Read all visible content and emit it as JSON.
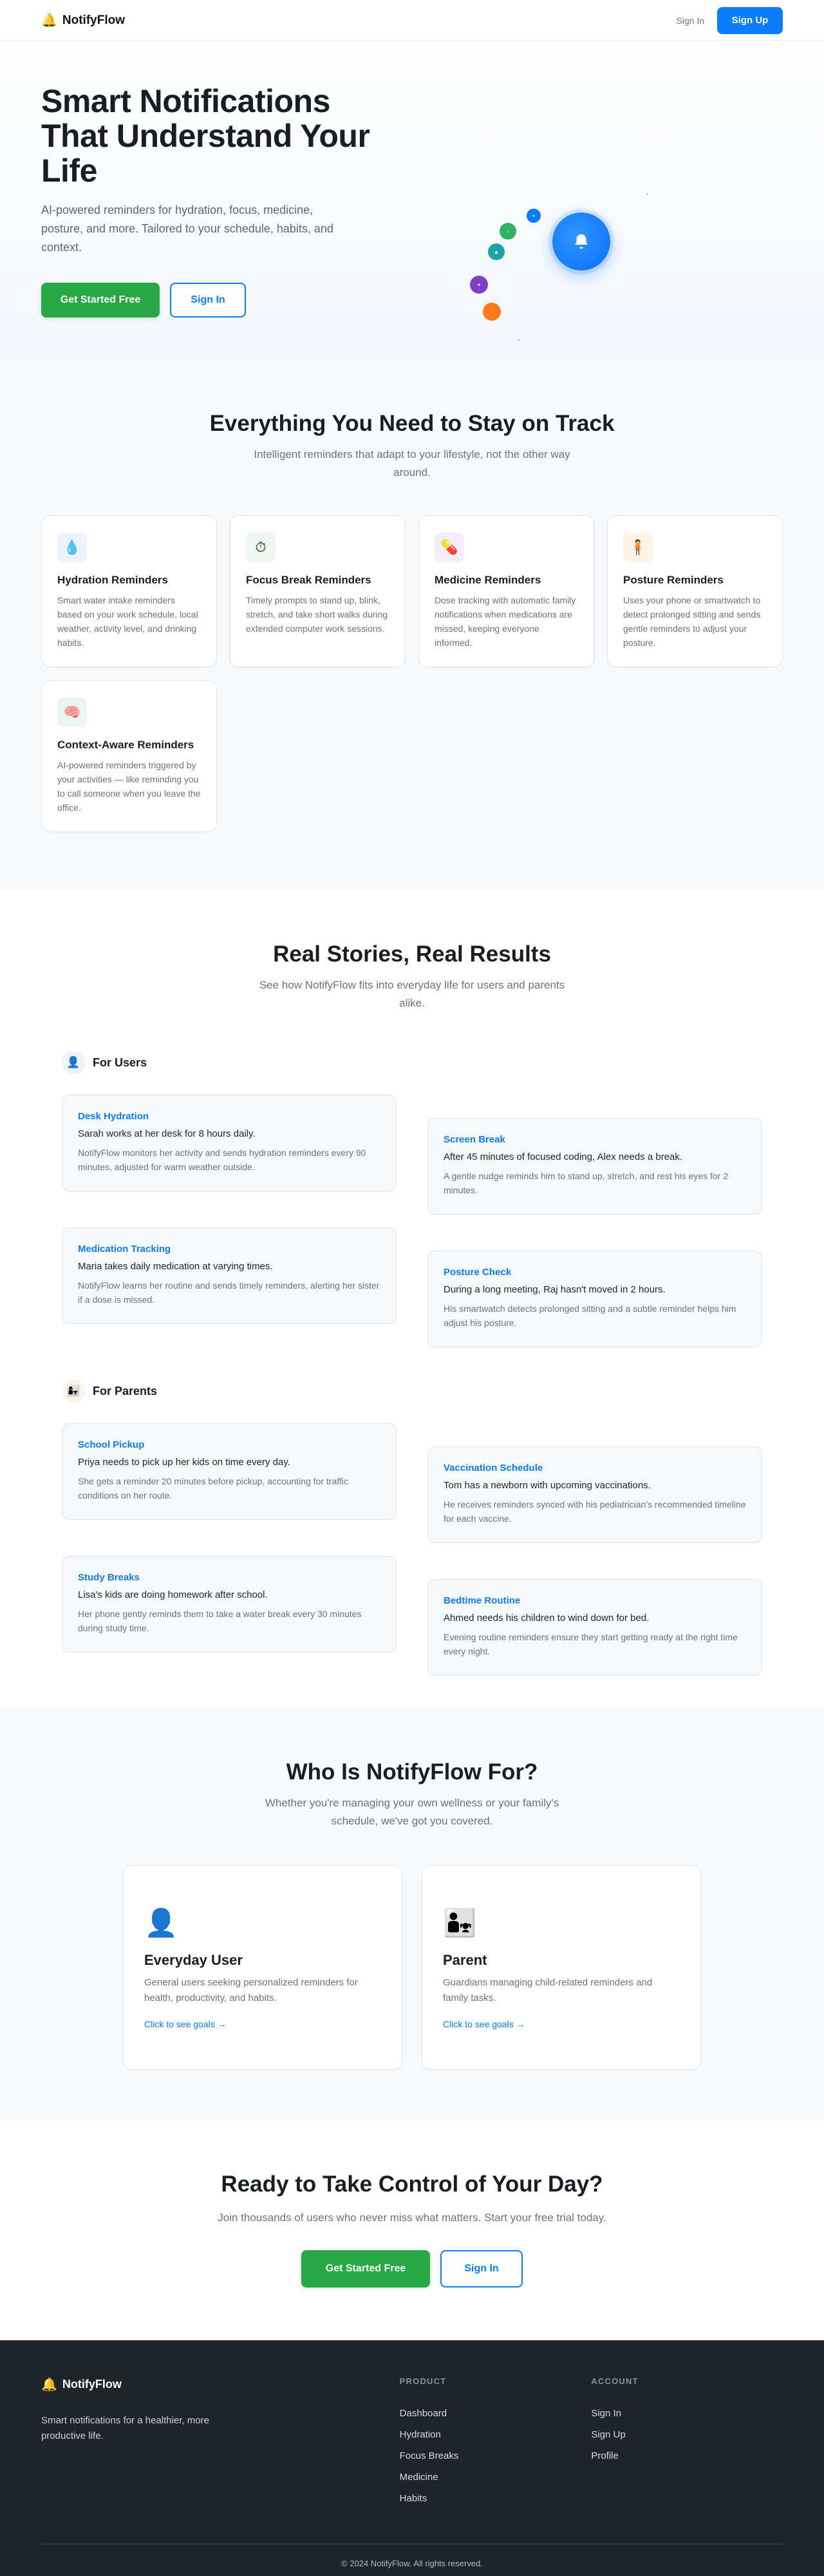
{
  "nav": {
    "brand": "NotifyFlow",
    "brand_icon": "bell-icon",
    "sign_in": "Sign In",
    "sign_up": "Sign Up"
  },
  "hero": {
    "title": "Smart Notifications That Understand Your Life",
    "subtitle": "AI-powered reminders for hydration, focus, medicine, posture, and more. Tailored to your schedule, habits, and context.",
    "primary_cta": "Get Started Free",
    "secondary_cta": "Sign In"
  },
  "features": {
    "title": "Everything You Need to Stay on Track",
    "subtitle": "Intelligent reminders that adapt to your lifestyle, not the other way around.",
    "items": [
      {
        "icon": "💧",
        "title": "Hydration Reminders",
        "desc": "Smart water intake reminders based on your work schedule, local weather, activity level, and drinking habits."
      },
      {
        "icon": "⏱",
        "title": "Focus Break Reminders",
        "desc": "Timely prompts to stand up, blink, stretch, and take short walks during extended computer work sessions."
      },
      {
        "icon": "💊",
        "title": "Medicine Reminders",
        "desc": "Dose tracking with automatic family notifications when medications are missed, keeping everyone informed."
      },
      {
        "icon": "🧍",
        "title": "Posture Reminders",
        "desc": "Uses your phone or smartwatch to detect prolonged sitting and sends gentle reminders to adjust your posture."
      },
      {
        "icon": "🧠",
        "title": "Context-Aware Reminders",
        "desc": "AI-powered reminders triggered by your activities — like reminding you to call someone when you leave the office."
      }
    ]
  },
  "stories": {
    "title": "Real Stories, Real Results",
    "subtitle": "See how NotifyFlow fits into everyday life for users and parents alike.",
    "users_label": "For Users",
    "parents_label": "For Parents",
    "users": [
      {
        "title": "Desk Hydration",
        "lead": "Sarah works at her desk for 8 hours daily.",
        "detail": "NotifyFlow monitors her activity and sends hydration reminders every 90 minutes, adjusted for warm weather outside."
      },
      {
        "title": "Screen Break",
        "lead": "After 45 minutes of focused coding, Alex needs a break.",
        "detail": "A gentle nudge reminds him to stand up, stretch, and rest his eyes for 2 minutes."
      },
      {
        "title": "Medication Tracking",
        "lead": "Maria takes daily medication at varying times.",
        "detail": "NotifyFlow learns her routine and sends timely reminders, alerting her sister if a dose is missed."
      },
      {
        "title": "Posture Check",
        "lead": "During a long meeting, Raj hasn't moved in 2 hours.",
        "detail": "His smartwatch detects prolonged sitting and a subtle reminder helps him adjust his posture."
      }
    ],
    "parents": [
      {
        "title": "School Pickup",
        "lead": "Priya needs to pick up her kids on time every day.",
        "detail": "She gets a reminder 20 minutes before pickup, accounting for traffic conditions on her route."
      },
      {
        "title": "Vaccination Schedule",
        "lead": "Tom has a newborn with upcoming vaccinations.",
        "detail": "He receives reminders synced with his pediatrician's recommended timeline for each vaccine."
      },
      {
        "title": "Study Breaks",
        "lead": "Lisa's kids are doing homework after school.",
        "detail": "Her phone gently reminds them to take a water break every 30 minutes during study time."
      },
      {
        "title": "Bedtime Routine",
        "lead": "Ahmed needs his children to wind down for bed.",
        "detail": "Evening routine reminders ensure they start getting ready at the right time every night."
      }
    ]
  },
  "who": {
    "title": "Who Is NotifyFlow For?",
    "subtitle": "Whether you're managing your own wellness or your family's schedule, we've got you covered.",
    "cards": [
      {
        "icon": "👤",
        "title": "Everyday User",
        "desc": "General users seeking personalized reminders for health, productivity, and habits.",
        "cta": "Click to see goals →"
      },
      {
        "icon": "👨‍👧",
        "title": "Parent",
        "desc": "Guardians managing child-related reminders and family tasks.",
        "cta": "Click to see goals →"
      }
    ]
  },
  "ready": {
    "title": "Ready to Take Control of Your Day?",
    "subtitle": "Join thousands of users who never miss what matters. Start your free trial today.",
    "primary_cta": "Get Started Free",
    "secondary_cta": "Sign In"
  },
  "footer": {
    "brand": "NotifyFlow",
    "tagline": "Smart notifications for a healthier, more productive life.",
    "product_heading": "PRODUCT",
    "product_links": [
      "Dashboard",
      "Hydration",
      "Focus Breaks",
      "Medicine",
      "Habits"
    ],
    "account_heading": "ACCOUNT",
    "account_links": [
      "Sign In",
      "Sign Up",
      "Profile"
    ],
    "copyright": "© 2024 NotifyFlow. All rights reserved."
  },
  "colors": {
    "primary": "#0a7cff",
    "green": "#28a745",
    "footer_bg": "#1f2428"
  }
}
